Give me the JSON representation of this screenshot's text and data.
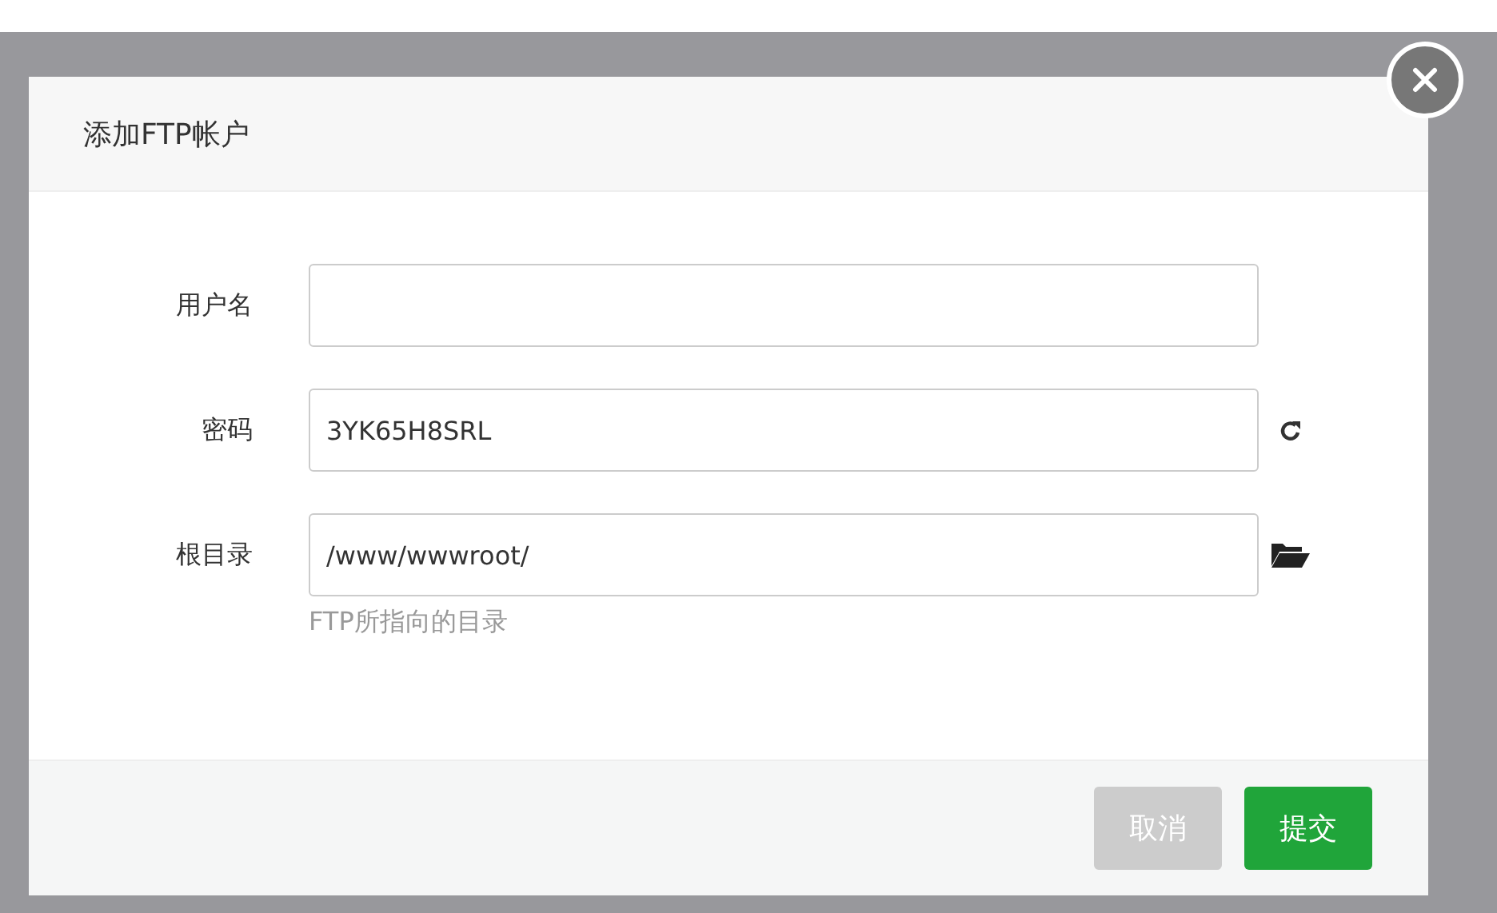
{
  "dialog": {
    "title": "添加FTP帐户"
  },
  "fields": [
    {
      "label": "用户名",
      "kind": "plain"
    },
    {
      "label": "密码",
      "value": "3YK65H8SRL",
      "kind": "refresh"
    },
    {
      "label": "根目录",
      "value": "/www/wwwroot/",
      "kind": "folder"
    }
  ],
  "hint": "FTP所指向的目录",
  "buttons": [
    {
      "label": "取消",
      "kind": "cancel"
    },
    {
      "label": "提交",
      "kind": "submit"
    }
  ]
}
